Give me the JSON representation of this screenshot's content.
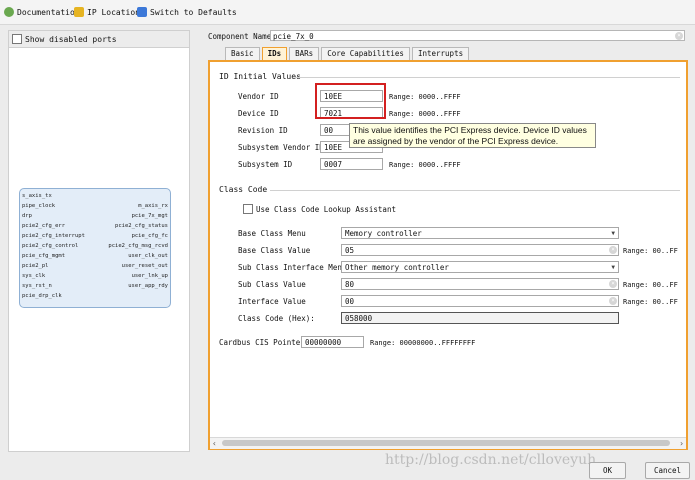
{
  "toolbar": {
    "documentation_label": "Documentation",
    "ip_location_label": "IP Location",
    "switch_defaults_label": "Switch to Defaults"
  },
  "left_pane": {
    "show_disabled_label": "Show disabled ports",
    "block": {
      "left_ports": [
        "s_axis_tx",
        "pipe_clock",
        "drp",
        "pcie2_cfg_err",
        "pcie2_cfg_interrupt",
        "pcie2_cfg_control",
        "pcie_cfg_mgmt",
        "pcie2_pl"
      ],
      "right_ports": [
        "m_axis_rx",
        "pcie_7x_mgt",
        "pcie2_cfg_status",
        "pcie_cfg_fc",
        "pcie2_cfg_msg_rcvd",
        "user_clk_out",
        "user_reset_out",
        "user_lnk_up",
        "user_app_rdy"
      ],
      "external_ports": [
        "sys_clk",
        "sys_rst_n",
        "pcie_drp_clk"
      ]
    }
  },
  "component": {
    "name_label": "Component Name",
    "name_value": "pcie_7x_0"
  },
  "tabs": [
    "Basic",
    "IDs",
    "BARs",
    "Core Capabilities",
    "Interrupts"
  ],
  "active_tab": "IDs",
  "id_initial_values": {
    "title": "ID Initial Values",
    "vendor_id": {
      "label": "Vendor ID",
      "value": "10EE",
      "range": "Range: 0000..FFFF"
    },
    "device_id": {
      "label": "Device ID",
      "value": "7021",
      "range": "Range: 0000..FFFF"
    },
    "revision_id": {
      "label": "Revision ID",
      "value": "00"
    },
    "subsystem_vendor_id": {
      "label": "Subsystem Vendor ID",
      "value": "10EE"
    },
    "subsystem_id": {
      "label": "Subsystem ID",
      "value": "0007",
      "range": "Range: 0000..FFFF"
    }
  },
  "tooltip": {
    "line1": "This value identifies the PCI Express device. Device ID values",
    "line2": "are assigned by the vendor of the PCI Express device."
  },
  "class_code": {
    "title": "Class Code",
    "lookup_label": "Use Class Code Lookup Assistant",
    "base_class_menu": {
      "label": "Base Class Menu",
      "value": "Memory controller"
    },
    "base_class_value": {
      "label": "Base Class Value",
      "value": "05",
      "range": "Range: 00..FF"
    },
    "sub_class_menu": {
      "label": "Sub Class Interface Menu",
      "value": "Other memory controller"
    },
    "sub_class_value": {
      "label": "Sub Class Value",
      "value": "80",
      "range": "Range: 00..FF"
    },
    "interface_value": {
      "label": "Interface Value",
      "value": "00",
      "range": "Range: 00..FF"
    },
    "class_code_hex": {
      "label": "Class Code (Hex):",
      "value": "058000"
    }
  },
  "cardbus": {
    "label": "Cardbus CIS Pointer",
    "value": "00000000",
    "range": "Range: 00000000..FFFFFFFF"
  },
  "buttons": {
    "ok": "OK",
    "cancel": "Cancel"
  },
  "watermark": "http://blog.csdn.net/clloveyuh"
}
